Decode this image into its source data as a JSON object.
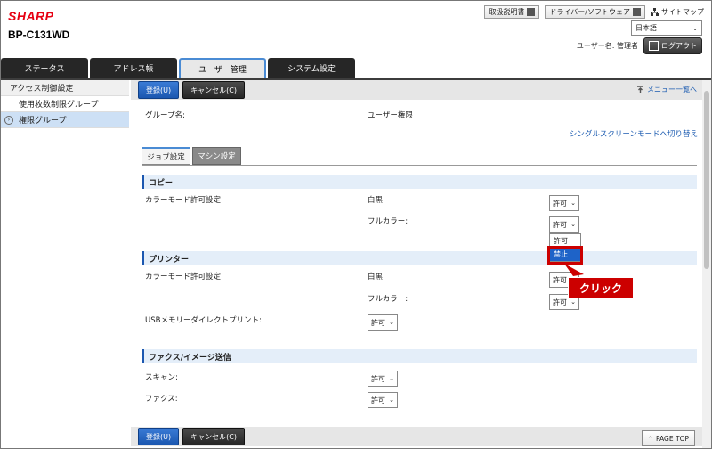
{
  "header": {
    "logo": "SHARP",
    "model": "BP-C131WD",
    "links": [
      "取扱説明書",
      "ドライバー/ソフトウェア"
    ],
    "sitemap": "サイトマップ",
    "language": "日本語",
    "user_label": "ユーザー名: 管理者",
    "logout": "ログアウト"
  },
  "tabs": [
    "ステータス",
    "アドレス帳",
    "ユーザー管理",
    "システム設定"
  ],
  "sidebar": {
    "items": [
      "アクセス制御設定",
      "使用枚数制限グループ",
      "権限グループ"
    ]
  },
  "actions": {
    "register": "登録(U)",
    "cancel": "キャンセル(C)",
    "menu_back": "メニュー一覧へ",
    "page_top": "PAGE TOP"
  },
  "group": {
    "label": "グループ名:",
    "value": "ユーザー権限",
    "single_screen_link": "シングルスクリーンモードへ切り替え"
  },
  "subtabs": [
    "ジョブ設定",
    "マシン設定"
  ],
  "sections": {
    "copy": {
      "title": "コピー",
      "color_mode_label": "カラーモード許可設定:",
      "bw_label": "白黒:",
      "bw_value": "許可",
      "full_label": "フルカラー:",
      "full_value": "許可"
    },
    "printer": {
      "title": "プリンター",
      "color_mode_label": "カラーモード許可設定:",
      "bw_label": "白黒:",
      "bw_value": "許可",
      "full_label": "フルカラー:",
      "full_value": "許可",
      "usb_label": "USBメモリーダイレクトプリント:",
      "usb_value": "許可"
    },
    "fax": {
      "title": "ファクス/イメージ送信",
      "scan_label": "スキャン:",
      "scan_value": "許可",
      "fax_label": "ファクス:",
      "fax_value": "許可"
    }
  },
  "dropdown": {
    "options": [
      "許可",
      "禁止"
    ],
    "highlighted": "禁止"
  },
  "annotation": {
    "click_label": "クリック",
    "color": "#cc0000"
  }
}
